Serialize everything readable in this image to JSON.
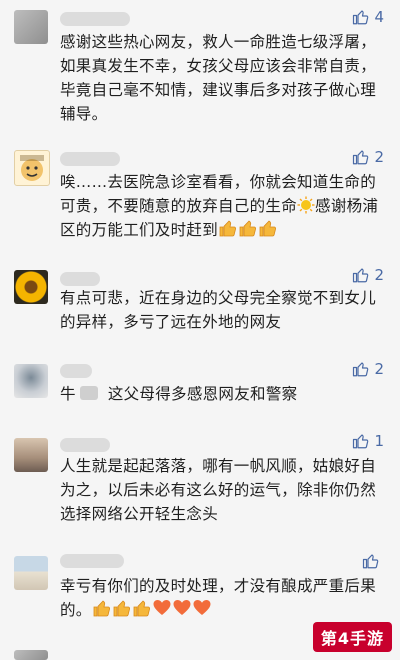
{
  "comments": [
    {
      "text": "感谢这些热心网友，救人一命胜造七级浮屠，如果真发生不幸，女孩父母应该会非常自责，毕竟自己毫不知情，建议事后多对孩子做心理辅导。",
      "likes": "4"
    },
    {
      "text_a": "唉……去医院急诊室看看，你就会知道生命的可贵，不要随意的放弃自己的生命",
      "text_b": "感谢杨浦区的万能工们及时赶到",
      "likes": "2"
    },
    {
      "text": "有点可悲，近在身边的父母完全察觉不到女儿的异样，多亏了远在外地的网友",
      "likes": "2"
    },
    {
      "prefix": "牛",
      "text": "这父母得多感恩网友和警察",
      "likes": "2"
    },
    {
      "text": "人生就是起起落落，哪有一帆风顺，姑娘好自为之，以后未必有这么好的运气，除非你仍然选择网络公开轻生念头",
      "likes": "1"
    },
    {
      "text": "幸亏有你们的及时处理，才没有酿成严重后果的。",
      "likes": ""
    }
  ],
  "watermark": "第4手游",
  "colors": {
    "like": "#4a6aa5",
    "watermark_bg": "#c8002d"
  }
}
